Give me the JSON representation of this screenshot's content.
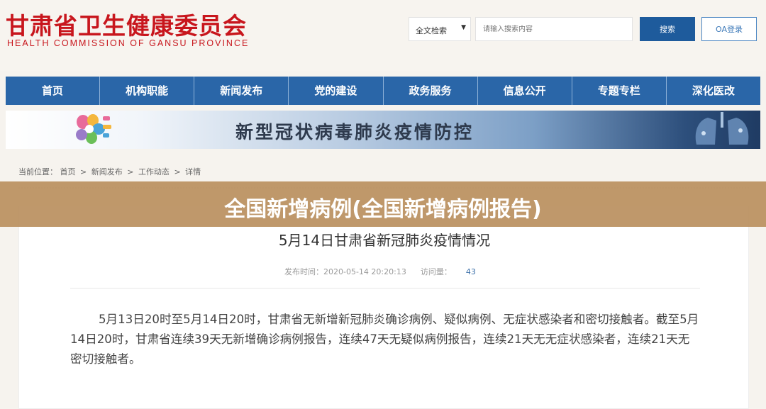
{
  "header": {
    "logo_cn": "甘肃省卫生健康委员会",
    "logo_en": "HEALTH COMMISSION OF GANSU PROVINCE",
    "search_type": "全文检索",
    "search_placeholder": "请输入搜索内容",
    "search_button": "搜索",
    "oa_button": "OA登录"
  },
  "nav": {
    "items": [
      {
        "label": "首页"
      },
      {
        "label": "机构职能"
      },
      {
        "label": "新闻发布"
      },
      {
        "label": "党的建设"
      },
      {
        "label": "政务服务"
      },
      {
        "label": "信息公开"
      },
      {
        "label": "专题专栏"
      },
      {
        "label": "深化医改"
      }
    ]
  },
  "banner": {
    "title": "新型冠状病毒肺炎疫情防控"
  },
  "breadcrumb": {
    "prefix": "当前位置：",
    "items": [
      "首页",
      "新闻发布",
      "工作动态",
      "详情"
    ],
    "separator": ">"
  },
  "overlay": {
    "title": "全国新增病例(全国新增病例报告)"
  },
  "article": {
    "title": "5月14日甘肃省新冠肺炎疫情情况",
    "date_label": "发布时间：",
    "date": "2020-05-14 20:20:13",
    "views_label": "访问量：",
    "views": "43",
    "paragraph": "5月13日20时至5月14日20时，甘肃省无新增新冠肺炎确诊病例、疑似病例、无症状感染者和密切接触者。截至5月14日20时，甘肃省连续39天无新增确诊病例报告，连续47天无疑似病例报告，连续21天无无症状感染者，连续21天无密切接触者。"
  },
  "colors": {
    "brand_red": "#c8161d",
    "nav_blue": "#2a66a8",
    "overlay_tan": "#ba9060"
  }
}
